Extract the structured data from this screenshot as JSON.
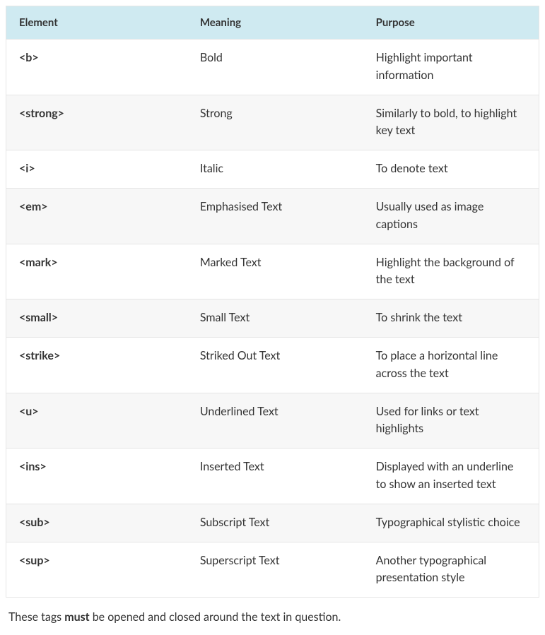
{
  "table": {
    "headers": {
      "element": "Element",
      "meaning": "Meaning",
      "purpose": "Purpose"
    },
    "rows": [
      {
        "element": "<b>",
        "meaning": "Bold",
        "purpose": "Highlight important information"
      },
      {
        "element": "<strong>",
        "meaning": "Strong",
        "purpose": "Similarly to bold, to highlight key text"
      },
      {
        "element": "<i>",
        "meaning": "Italic",
        "purpose": "To denote text"
      },
      {
        "element": "<em>",
        "meaning": "Emphasised Text",
        "purpose": "Usually used as image captions"
      },
      {
        "element": "<mark>",
        "meaning": "Marked Text",
        "purpose": "Highlight the background of the text"
      },
      {
        "element": "<small>",
        "meaning": "Small Text",
        "purpose": "To shrink the text"
      },
      {
        "element": "<strike>",
        "meaning": "Striked Out Text",
        "purpose": "To place a horizontal line across the text"
      },
      {
        "element": "<u>",
        "meaning": "Underlined Text",
        "purpose": "Used for links or text highlights"
      },
      {
        "element": "<ins>",
        "meaning": "Inserted Text",
        "purpose": "Displayed with an underline to show an inserted text"
      },
      {
        "element": "<sub>",
        "meaning": "Subscript Text",
        "purpose": "Typographical stylistic choice"
      },
      {
        "element": "<sup>",
        "meaning": "Superscript Text",
        "purpose": "Another typographical presentation style"
      }
    ]
  },
  "footer": {
    "prefix": "These tags ",
    "strong": "must",
    "suffix": " be opened and closed around the text in question."
  }
}
